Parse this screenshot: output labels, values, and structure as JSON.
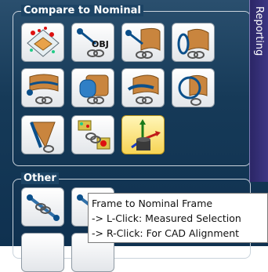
{
  "compare_group": {
    "title": "Compare to Nominal",
    "buttons": [
      {
        "icon": "compare-points-icon"
      },
      {
        "icon": "obj-link-icon",
        "badge": "OBJ"
      },
      {
        "icon": "surface-link-icon"
      },
      {
        "icon": "cylinder-link-icon"
      },
      {
        "icon": "surface-offset-icon"
      },
      {
        "icon": "cylinder-surface-icon"
      },
      {
        "icon": "tube-link-icon"
      },
      {
        "icon": "circle-cylinder-icon"
      },
      {
        "icon": "cone-link-icon"
      },
      {
        "icon": "point-cloud-target-icon"
      },
      {
        "icon": "frame-to-nominal-icon",
        "active": true
      }
    ]
  },
  "other_group": {
    "title": "Other"
  },
  "side_tab": {
    "label": "Reporting"
  },
  "tooltip": {
    "line1": "Frame to Nominal Frame",
    "line2": "-> L-Click: Measured Selection",
    "line3": "-> R-Click: For CAD Alignment"
  },
  "colors": {
    "panel": "#163a58",
    "active_button": "#f7d455",
    "side_tab": "#3e3785"
  }
}
